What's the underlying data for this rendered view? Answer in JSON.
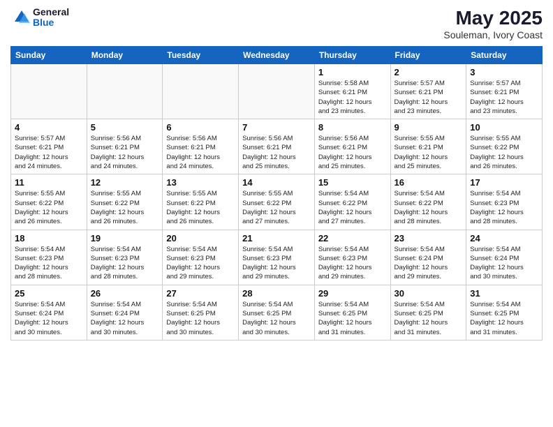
{
  "header": {
    "logo_general": "General",
    "logo_blue": "Blue",
    "month_year": "May 2025",
    "location": "Souleman, Ivory Coast"
  },
  "days_of_week": [
    "Sunday",
    "Monday",
    "Tuesday",
    "Wednesday",
    "Thursday",
    "Friday",
    "Saturday"
  ],
  "weeks": [
    [
      {
        "day": "",
        "detail": ""
      },
      {
        "day": "",
        "detail": ""
      },
      {
        "day": "",
        "detail": ""
      },
      {
        "day": "",
        "detail": ""
      },
      {
        "day": "1",
        "detail": "Sunrise: 5:58 AM\nSunset: 6:21 PM\nDaylight: 12 hours\nand 23 minutes."
      },
      {
        "day": "2",
        "detail": "Sunrise: 5:57 AM\nSunset: 6:21 PM\nDaylight: 12 hours\nand 23 minutes."
      },
      {
        "day": "3",
        "detail": "Sunrise: 5:57 AM\nSunset: 6:21 PM\nDaylight: 12 hours\nand 23 minutes."
      }
    ],
    [
      {
        "day": "4",
        "detail": "Sunrise: 5:57 AM\nSunset: 6:21 PM\nDaylight: 12 hours\nand 24 minutes."
      },
      {
        "day": "5",
        "detail": "Sunrise: 5:56 AM\nSunset: 6:21 PM\nDaylight: 12 hours\nand 24 minutes."
      },
      {
        "day": "6",
        "detail": "Sunrise: 5:56 AM\nSunset: 6:21 PM\nDaylight: 12 hours\nand 24 minutes."
      },
      {
        "day": "7",
        "detail": "Sunrise: 5:56 AM\nSunset: 6:21 PM\nDaylight: 12 hours\nand 25 minutes."
      },
      {
        "day": "8",
        "detail": "Sunrise: 5:56 AM\nSunset: 6:21 PM\nDaylight: 12 hours\nand 25 minutes."
      },
      {
        "day": "9",
        "detail": "Sunrise: 5:55 AM\nSunset: 6:21 PM\nDaylight: 12 hours\nand 25 minutes."
      },
      {
        "day": "10",
        "detail": "Sunrise: 5:55 AM\nSunset: 6:22 PM\nDaylight: 12 hours\nand 26 minutes."
      }
    ],
    [
      {
        "day": "11",
        "detail": "Sunrise: 5:55 AM\nSunset: 6:22 PM\nDaylight: 12 hours\nand 26 minutes."
      },
      {
        "day": "12",
        "detail": "Sunrise: 5:55 AM\nSunset: 6:22 PM\nDaylight: 12 hours\nand 26 minutes."
      },
      {
        "day": "13",
        "detail": "Sunrise: 5:55 AM\nSunset: 6:22 PM\nDaylight: 12 hours\nand 26 minutes."
      },
      {
        "day": "14",
        "detail": "Sunrise: 5:55 AM\nSunset: 6:22 PM\nDaylight: 12 hours\nand 27 minutes."
      },
      {
        "day": "15",
        "detail": "Sunrise: 5:54 AM\nSunset: 6:22 PM\nDaylight: 12 hours\nand 27 minutes."
      },
      {
        "day": "16",
        "detail": "Sunrise: 5:54 AM\nSunset: 6:22 PM\nDaylight: 12 hours\nand 28 minutes."
      },
      {
        "day": "17",
        "detail": "Sunrise: 5:54 AM\nSunset: 6:23 PM\nDaylight: 12 hours\nand 28 minutes."
      }
    ],
    [
      {
        "day": "18",
        "detail": "Sunrise: 5:54 AM\nSunset: 6:23 PM\nDaylight: 12 hours\nand 28 minutes."
      },
      {
        "day": "19",
        "detail": "Sunrise: 5:54 AM\nSunset: 6:23 PM\nDaylight: 12 hours\nand 28 minutes."
      },
      {
        "day": "20",
        "detail": "Sunrise: 5:54 AM\nSunset: 6:23 PM\nDaylight: 12 hours\nand 29 minutes."
      },
      {
        "day": "21",
        "detail": "Sunrise: 5:54 AM\nSunset: 6:23 PM\nDaylight: 12 hours\nand 29 minutes."
      },
      {
        "day": "22",
        "detail": "Sunrise: 5:54 AM\nSunset: 6:23 PM\nDaylight: 12 hours\nand 29 minutes."
      },
      {
        "day": "23",
        "detail": "Sunrise: 5:54 AM\nSunset: 6:24 PM\nDaylight: 12 hours\nand 29 minutes."
      },
      {
        "day": "24",
        "detail": "Sunrise: 5:54 AM\nSunset: 6:24 PM\nDaylight: 12 hours\nand 30 minutes."
      }
    ],
    [
      {
        "day": "25",
        "detail": "Sunrise: 5:54 AM\nSunset: 6:24 PM\nDaylight: 12 hours\nand 30 minutes."
      },
      {
        "day": "26",
        "detail": "Sunrise: 5:54 AM\nSunset: 6:24 PM\nDaylight: 12 hours\nand 30 minutes."
      },
      {
        "day": "27",
        "detail": "Sunrise: 5:54 AM\nSunset: 6:25 PM\nDaylight: 12 hours\nand 30 minutes."
      },
      {
        "day": "28",
        "detail": "Sunrise: 5:54 AM\nSunset: 6:25 PM\nDaylight: 12 hours\nand 30 minutes."
      },
      {
        "day": "29",
        "detail": "Sunrise: 5:54 AM\nSunset: 6:25 PM\nDaylight: 12 hours\nand 31 minutes."
      },
      {
        "day": "30",
        "detail": "Sunrise: 5:54 AM\nSunset: 6:25 PM\nDaylight: 12 hours\nand 31 minutes."
      },
      {
        "day": "31",
        "detail": "Sunrise: 5:54 AM\nSunset: 6:25 PM\nDaylight: 12 hours\nand 31 minutes."
      }
    ]
  ]
}
